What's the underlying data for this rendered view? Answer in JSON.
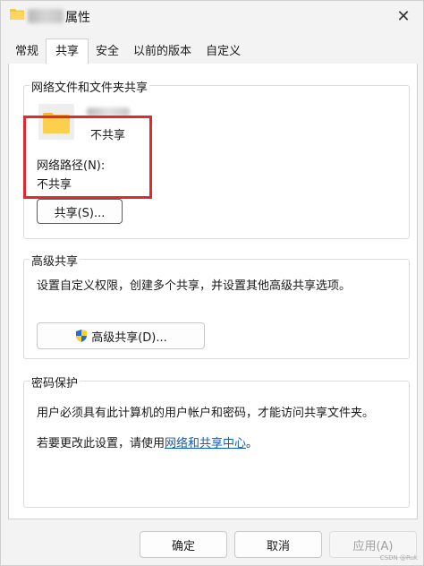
{
  "window": {
    "title": "属性",
    "close_glyph": "✕"
  },
  "tabs": [
    {
      "label": "常规"
    },
    {
      "label": "共享"
    },
    {
      "label": "安全"
    },
    {
      "label": "以前的版本"
    },
    {
      "label": "自定义"
    }
  ],
  "sharing": {
    "group_title": "网络文件和文件夹共享",
    "share_status": "不共享",
    "network_path_label": "网络路径(N):",
    "network_path_value": "不共享",
    "share_button": "共享(S)..."
  },
  "advanced": {
    "group_title": "高级共享",
    "description": "设置自定义权限，创建多个共享，并设置其他高级共享选项。",
    "button": "高级共享(D)..."
  },
  "password": {
    "group_title": "密码保护",
    "description": "用户必须具有此计算机的用户帐户和密码，才能访问共享文件夹。",
    "change_prefix": "若要更改此设置，请使用",
    "change_link": "网络和共享中心",
    "change_suffix": "。"
  },
  "footer": {
    "ok": "确定",
    "cancel": "取消",
    "apply": "应用(A)"
  },
  "watermark": "CSDN @Ruk"
}
